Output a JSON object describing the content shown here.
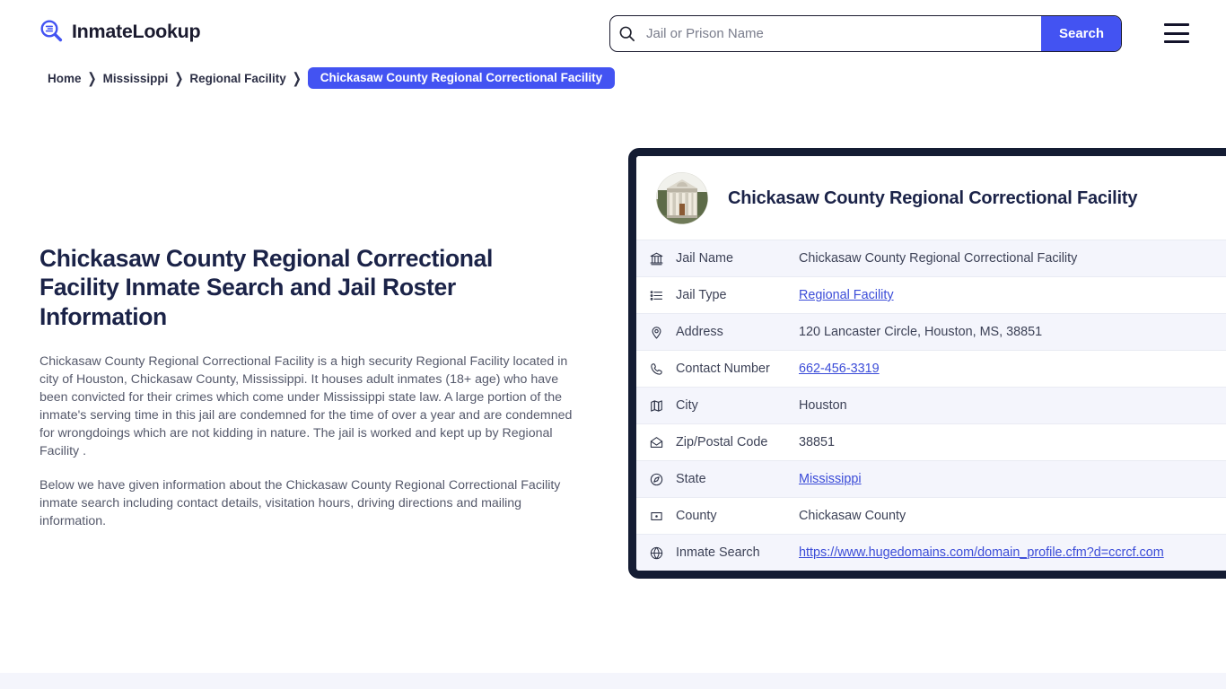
{
  "header": {
    "brand_name": "InmateLookup",
    "brand_icon": "magnifier-logo-icon",
    "search": {
      "placeholder": "Jail or Prison Name",
      "value": "",
      "icon": "search-icon",
      "button_label": "Search"
    },
    "menu_icon": "hamburger-menu-icon"
  },
  "breadcrumb": {
    "items": [
      {
        "label": "Home",
        "current": false
      },
      {
        "label": "Mississippi",
        "current": false
      },
      {
        "label": "Regional Facility",
        "current": false
      },
      {
        "label": "Chickasaw County Regional Correctional Facility",
        "current": true
      }
    ],
    "separator": "❯"
  },
  "article": {
    "heading": "Chickasaw County Regional Correctional Facility Inmate Search and Jail Roster Information",
    "paragraph_1": "Chickasaw County Regional Correctional Facility is a high security Regional Facility located in city of Houston, Chickasaw County, Mississippi. It houses adult inmates (18+ age) who have been convicted for their crimes which come under Mississippi state law. A large portion of the inmate's serving time in this jail are condemned for the time of over a year and are condemned for wrongdoings which are not kidding in nature. The jail is worked and kept up by Regional Facility .",
    "paragraph_2": "Below we have given information about the Chickasaw County Regional Correctional Facility inmate search including contact details, visitation hours, driving directions and mailing information."
  },
  "facility_card": {
    "title": "Chickasaw County Regional Correctional Facility",
    "avatar_icon": "courthouse-photo",
    "rows": [
      {
        "icon": "bank-building-icon",
        "label": "Jail Name",
        "value": "Chickasaw County Regional Correctional Facility",
        "link": false
      },
      {
        "icon": "list-icon",
        "label": "Jail Type",
        "value": "Regional Facility",
        "link": true
      },
      {
        "icon": "map-pin-icon",
        "label": "Address",
        "value": "120 Lancaster Circle, Houston, MS, 38851",
        "link": false
      },
      {
        "icon": "phone-icon",
        "label": "Contact Number",
        "value": "662-456-3319",
        "link": true
      },
      {
        "icon": "map-icon",
        "label": "City",
        "value": "Houston",
        "link": false
      },
      {
        "icon": "envelope-icon",
        "label": "Zip/Postal Code",
        "value": "38851",
        "link": false
      },
      {
        "icon": "globe-compass-icon",
        "label": "State",
        "value": "Mississippi",
        "link": true
      },
      {
        "icon": "county-marker-icon",
        "label": "County",
        "value": "Chickasaw County",
        "link": false
      },
      {
        "icon": "globe-icon",
        "label": "Inmate Search",
        "value": "https://www.hugedomains.com/domain_profile.cfm?d=ccrcf.com",
        "link": true
      }
    ]
  },
  "colors": {
    "accent": "#4353f2",
    "link": "#3b4cd8",
    "heading": "#1b2348",
    "card_border": "#141c33",
    "row_alt": "#f4f5fc",
    "body_text": "#55596b"
  }
}
